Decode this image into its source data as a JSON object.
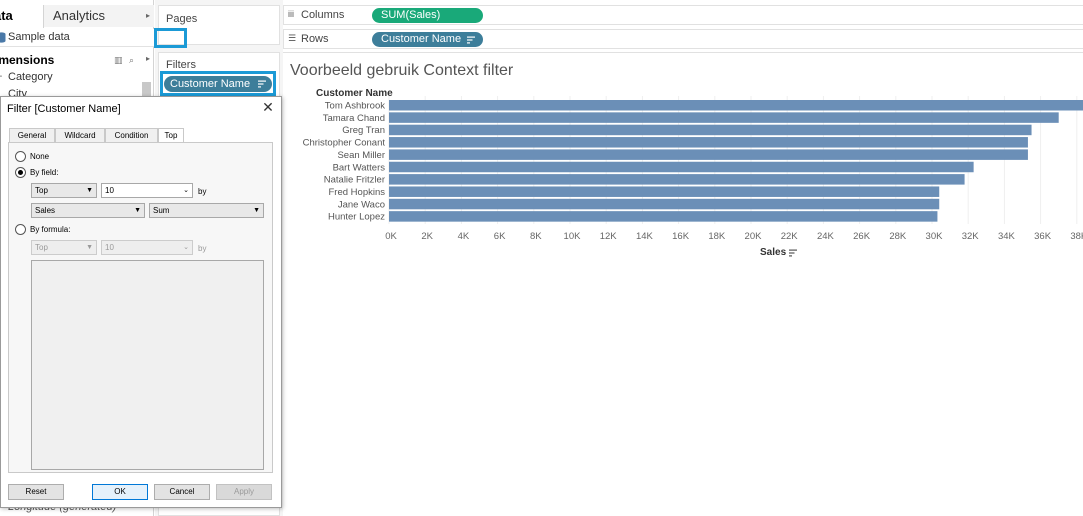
{
  "data_pane": {
    "tabs": [
      {
        "label": "ata"
      },
      {
        "label": "Analytics"
      }
    ],
    "datasource": "Sample data",
    "dimensions_label": "imensions",
    "fields": {
      "category": "Category",
      "city": "City",
      "longitude": "Longitude (generated)"
    }
  },
  "pages": {
    "label": "Pages"
  },
  "filters": {
    "label": "Filters",
    "pill": "Customer Name"
  },
  "shelves": {
    "columns_label": "Columns",
    "columns_pill": "SUM(Sales)",
    "rows_label": "Rows",
    "rows_pill": "Customer Name"
  },
  "viz": {
    "title": "Voorbeeld gebruik Context filter",
    "row_header": "Customer Name",
    "x_axis_title": "Sales"
  },
  "chart_data": {
    "type": "bar",
    "orientation": "horizontal",
    "title": "Voorbeeld gebruik Context filter",
    "xlabel": "Sales",
    "ylabel": "Customer Name",
    "categories": [
      "Tom Ashbrook",
      "Tamara Chand",
      "Greg Tran",
      "Christopher Conant",
      "Sean Miller",
      "Bart Watters",
      "Natalie Fritzler",
      "Fred Hopkins",
      "Jane Waco",
      "Hunter Lopez"
    ],
    "values": [
      38400,
      37000,
      35500,
      35300,
      35300,
      32300,
      31800,
      30400,
      30400,
      30300
    ],
    "x_ticks": [
      "0K",
      "2K",
      "4K",
      "6K",
      "8K",
      "10K",
      "12K",
      "14K",
      "16K",
      "18K",
      "20K",
      "22K",
      "24K",
      "26K",
      "28K",
      "30K",
      "32K",
      "34K",
      "36K",
      "38K"
    ],
    "xlim": [
      0,
      38500
    ],
    "bar_color": "#6b8fb7",
    "grid": true
  },
  "dialog": {
    "title": "Filter [Customer Name]",
    "close": "✕",
    "tabs": [
      {
        "label": "General"
      },
      {
        "label": "Wildcard"
      },
      {
        "label": "Condition"
      },
      {
        "label": "Top"
      }
    ],
    "none_label": "None",
    "by_field_label": "By field:",
    "by_field_mode": "Top",
    "by_field_count": "10",
    "by_label": "by",
    "by_field_field": "Sales",
    "by_field_agg": "Sum",
    "by_formula_label": "By formula:",
    "by_formula_mode": "Top",
    "by_formula_count": "10",
    "buttons": {
      "reset": "Reset",
      "ok": "OK",
      "cancel": "Cancel",
      "apply": "Apply"
    }
  }
}
